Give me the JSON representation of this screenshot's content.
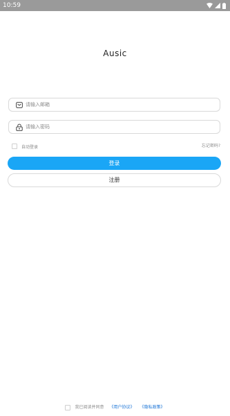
{
  "status_bar": {
    "time": "10:59",
    "icons": [
      "wifi-icon",
      "signal-icon",
      "battery-icon"
    ]
  },
  "app": {
    "title": "Ausic"
  },
  "login_form": {
    "email_placeholder": "请输入邮箱",
    "email_value": "",
    "password_placeholder": "请输入密码",
    "password_value": "",
    "remember_label": "自动登录",
    "remember_checked": false,
    "forgot_label": "忘记密码?",
    "login_label": "登录",
    "register_label": "注册"
  },
  "agreement": {
    "checked": false,
    "text": "我已阅读并同意",
    "user_agreement": "《用户协议》",
    "privacy_policy": "《隐私政策》"
  },
  "colors": {
    "status_bar": "#9a9a9a",
    "primary": "#1aa6f6",
    "link": "#1a74d6",
    "border": "#d9d9d9",
    "muted_text": "#8c8c8c"
  }
}
